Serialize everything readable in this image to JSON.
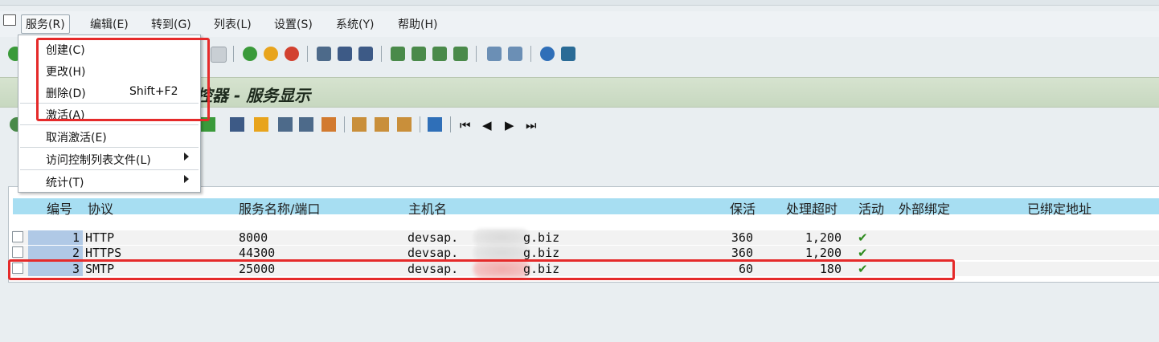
{
  "menu": {
    "items": [
      {
        "id": "service",
        "label": "服务(R)"
      },
      {
        "id": "edit",
        "label": "编辑(E)"
      },
      {
        "id": "goto",
        "label": "转到(G)"
      },
      {
        "id": "list",
        "label": "列表(L)"
      },
      {
        "id": "settings",
        "label": "设置(S)"
      },
      {
        "id": "system",
        "label": "系统(Y)"
      },
      {
        "id": "help",
        "label": "帮助(H)"
      }
    ]
  },
  "dropdown": {
    "create": "创建(C)",
    "change": "更改(H)",
    "delete": "删除(D)",
    "delete_shortcut": "Shift+F2",
    "activate": "激活(A)",
    "deactivate": "取消激活(E)",
    "acl": "访问控制列表文件(L)",
    "stats": "统计(T)"
  },
  "banner": {
    "title": "控器 - 服务显示"
  },
  "table": {
    "headers": [
      "编号",
      "协议",
      "服务名称/端口",
      "主机名",
      "保活",
      "处理超时",
      "活动",
      "外部绑定",
      "已绑定地址"
    ],
    "rows": [
      {
        "num": "1",
        "protocol": "HTTP",
        "port": "8000",
        "host": "devsap.",
        "host_suffix": "g.biz",
        "keepalive": "360",
        "timeout": "1,200",
        "active": true
      },
      {
        "num": "2",
        "protocol": "HTTPS",
        "port": "44300",
        "host": "devsap.",
        "host_suffix": "g.biz",
        "keepalive": "360",
        "timeout": "1,200",
        "active": true
      },
      {
        "num": "3",
        "protocol": "SMTP",
        "port": "25000",
        "host": "devsap.",
        "host_suffix": "g.biz",
        "keepalive": "60",
        "timeout": "180",
        "active": true
      }
    ]
  },
  "colors": {
    "highlight": "#e52a2a",
    "header_bg": "#a7def2",
    "check": "#2e8b1f"
  }
}
